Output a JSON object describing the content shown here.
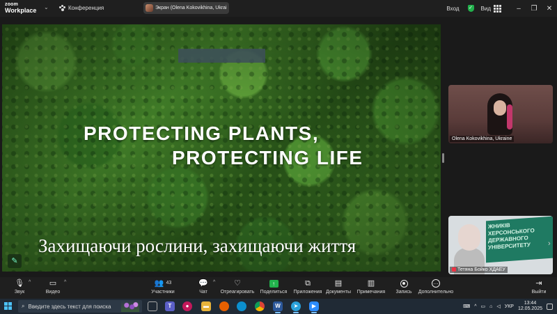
{
  "titlebar": {
    "brand_line1": "zoom",
    "brand_line2": "Workplace",
    "meeting_label": "Конференция",
    "share_indicator": "Экран (Olena Kokovikhina, Ukrai",
    "signin_label": "Вход",
    "view_label": "Вид",
    "icons": [
      "paw-icon",
      "shield-icon",
      "grid-icon",
      "minimize-icon",
      "restore-icon",
      "close-icon"
    ]
  },
  "slide": {
    "headline_line1": "PROTECTING PLANTS,",
    "headline_line2": "PROTECTING LIFE",
    "subtitle": "Захищаючи рослини, захищаючи життя"
  },
  "participants": [
    {
      "name": "Olena Kokovikhina, Ukraine"
    },
    {
      "name": "Тетяна Бойко ХДАЕУ"
    }
  ],
  "board_text": "ЖНИКІВ ХЕРСОНСЬКОГО ДЕРЖАВНОГО УНІВЕРСИТЕТУ",
  "toolbar": {
    "audio": "Звук",
    "video": "Видео",
    "participants": "Участники",
    "participants_count": "43",
    "chat": "Чат",
    "react": "Отреагировать",
    "share": "Поделиться",
    "apps": "Приложения",
    "docs": "Документы",
    "notes": "Примечания",
    "record": "Запись",
    "more": "Дополнительно",
    "leave": "Выйти"
  },
  "taskbar": {
    "search_placeholder": "Введите здесь текст для поиска",
    "language": "УКР",
    "time": "13:44",
    "date": "12.05.2025",
    "apps": [
      "task-view",
      "teams",
      "files",
      "firefox",
      "edge",
      "chrome",
      "word",
      "telegram",
      "zoom"
    ]
  },
  "colors": {
    "accent_green": "#22b14c",
    "taskbar_bg": "#202a35",
    "toolbar_bg": "#1f1f1f",
    "muted_red": "#e33344"
  }
}
